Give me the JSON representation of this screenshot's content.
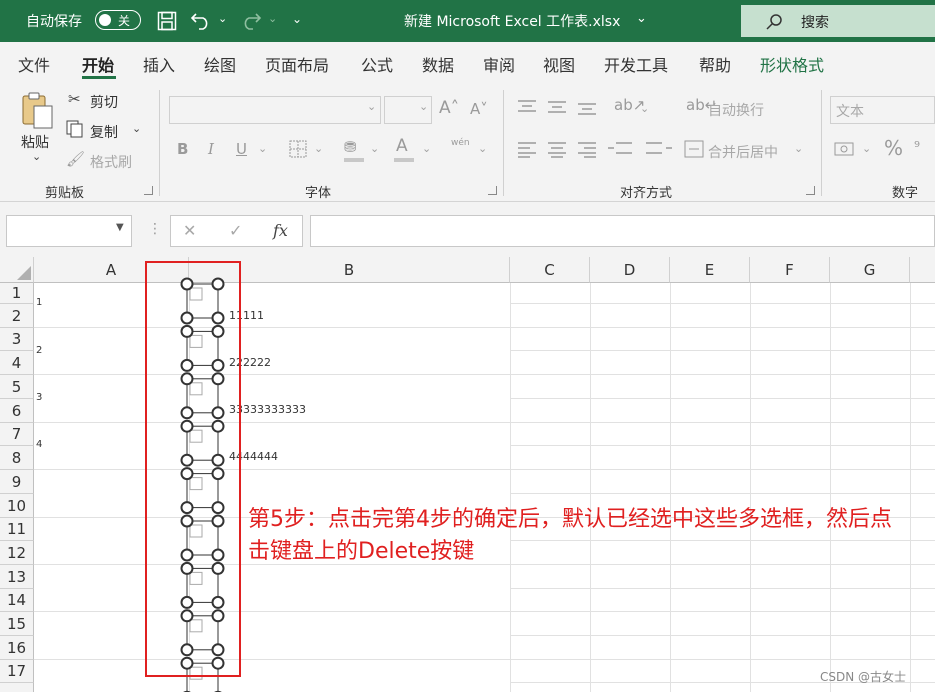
{
  "titlebar": {
    "autosave_label": "自动保存",
    "autosave_state": "关",
    "filename": "新建 Microsoft Excel 工作表.xlsx",
    "search_label": "搜索",
    "bg_color": "#217346"
  },
  "menu": {
    "tabs": [
      "文件",
      "开始",
      "插入",
      "绘图",
      "页面布局",
      "公式",
      "数据",
      "审阅",
      "视图",
      "开发工具",
      "帮助",
      "形状格式"
    ],
    "active_tab": "开始",
    "contextual_color": "#217346"
  },
  "ribbon": {
    "clipboard": {
      "paste": "粘贴",
      "cut": "剪切",
      "copy": "复制",
      "format_painter": "格式刷",
      "label": "剪贴板"
    },
    "font": {
      "bold": "B",
      "italic": "I",
      "underline": "U",
      "font_color_letter": "A",
      "phonetic": "wén",
      "label": "字体"
    },
    "alignment": {
      "wrap_text": "自动换行",
      "merge_center": "合并后居中",
      "label": "对齐方式"
    },
    "number": {
      "format_value": "文本",
      "percent": "%",
      "label": "数字"
    }
  },
  "formula_bar": {
    "cancel": "✕",
    "enter": "✓",
    "fx": "fx",
    "name_box_value": "",
    "formula_value": ""
  },
  "sheet": {
    "columns": [
      "A",
      "B",
      "C",
      "D",
      "E",
      "F",
      "G"
    ],
    "rows": [
      "1",
      "2",
      "3",
      "4",
      "5",
      "6",
      "7",
      "8",
      "9",
      "10",
      "11",
      "12",
      "13",
      "14",
      "15",
      "16",
      "17"
    ],
    "col_a_values": [
      "1",
      "2",
      "3",
      "4"
    ],
    "col_b_values": [
      "11111",
      "222222",
      "33333333333",
      "4444444"
    ]
  },
  "annotation": {
    "text": "第5步：点击完第4步的确定后，默认已经选中这些多选框，然后点击键盘上的Delete按键",
    "color": "#e02020"
  },
  "watermark": "CSDN @古女士"
}
